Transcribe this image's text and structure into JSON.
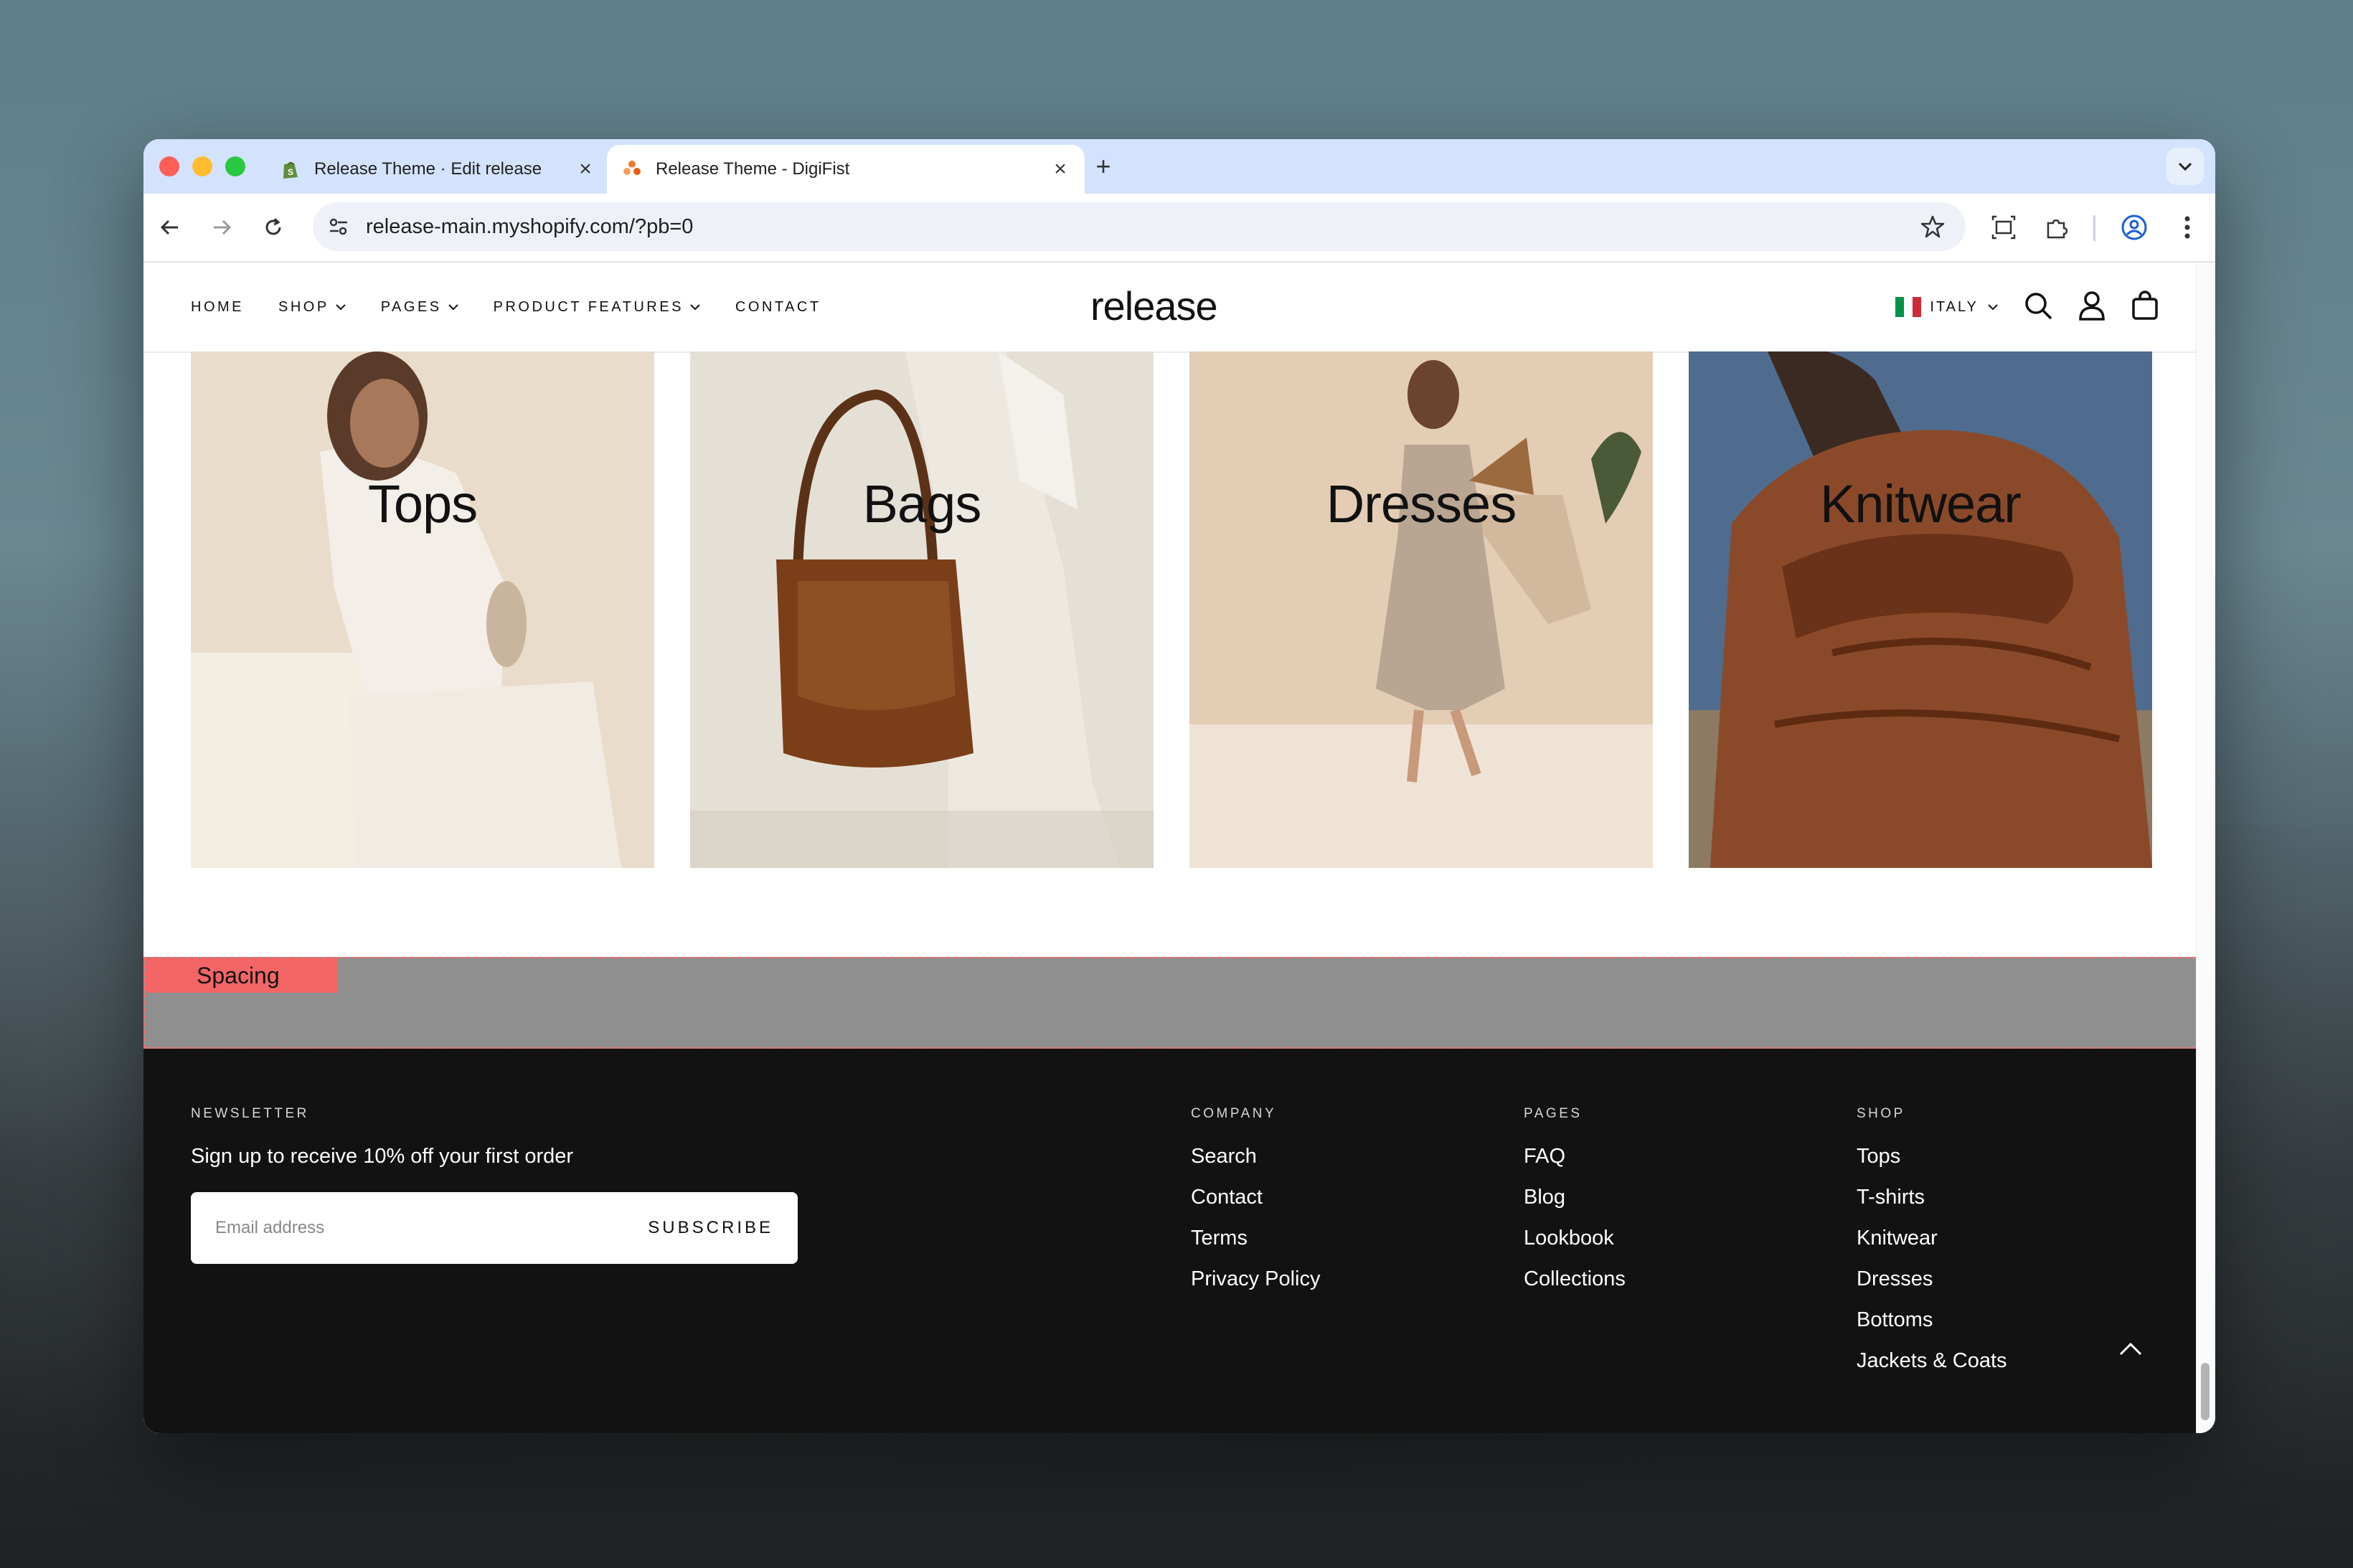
{
  "browser": {
    "tabs": [
      {
        "title": "Release Theme · Edit release",
        "favicon": "shopify-icon"
      },
      {
        "title": "Release Theme - DigiFist",
        "favicon": "digifist-icon"
      }
    ],
    "new_tab_label": "+",
    "address_url": "release-main.myshopify.com/?pb=0"
  },
  "site": {
    "nav": [
      "HOME",
      "SHOP",
      "PAGES",
      "PRODUCT FEATURES",
      "CONTACT"
    ],
    "logo": "release",
    "country": "ITALY"
  },
  "categories": [
    {
      "label": "Tops",
      "colors": [
        "#e9dccb",
        "#f3efe8",
        "#c9b59e"
      ]
    },
    {
      "label": "Bags",
      "colors": [
        "#e5e0d6",
        "#ede9e1",
        "#cfc8bb"
      ]
    },
    {
      "label": "Dresses",
      "colors": [
        "#e4cdb5",
        "#efe3d5",
        "#d2b89c"
      ]
    },
    {
      "label": "Knitwear",
      "colors": [
        "#4f6c8e",
        "#8a4a2a",
        "#6a3218"
      ]
    }
  ],
  "editor": {
    "spacing_label": "Spacing"
  },
  "footer": {
    "newsletter_heading": "NEWSLETTER",
    "newsletter_text": "Sign up to receive 10% off your first order",
    "email_placeholder": "Email address",
    "subscribe_label": "SUBSCRIBE",
    "company": {
      "heading": "COMPANY",
      "links": [
        "Search",
        "Contact",
        "Terms",
        "Privacy Policy"
      ]
    },
    "pages": {
      "heading": "PAGES",
      "links": [
        "FAQ",
        "Blog",
        "Lookbook",
        "Collections"
      ]
    },
    "shop": {
      "heading": "SHOP",
      "links": [
        "Tops",
        "T-shirts",
        "Knitwear",
        "Dresses",
        "Bottoms",
        "Jackets & Coats"
      ]
    }
  }
}
